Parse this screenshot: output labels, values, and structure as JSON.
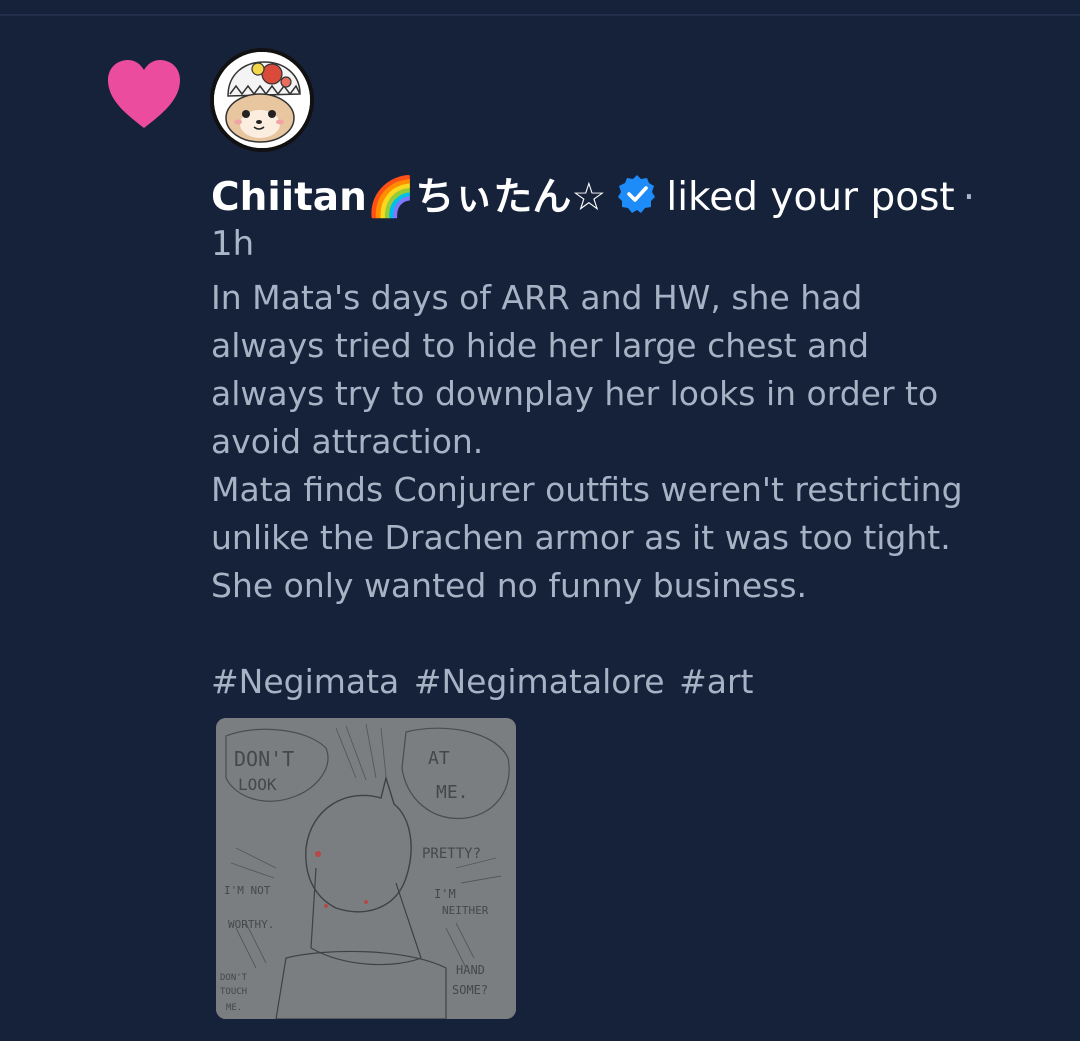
{
  "notification": {
    "type_icon": "heart-icon",
    "user": {
      "name": "Chiitan🌈ちぃたん☆",
      "verified": true,
      "avatar_icon": "avatar-image"
    },
    "action": "liked your post",
    "separator": "·",
    "time": "1h",
    "post": {
      "lines": [
        "In Mata's days of ARR and HW, she had",
        "always tried to hide her large chest and",
        "always try to downplay her looks in order to",
        "avoid attraction.",
        "Mata finds Conjurer outfits weren't restricting",
        "unlike the Drachen armor as it was too tight.",
        "She only wanted no funny business."
      ],
      "hashtags": [
        "#Negimata",
        "#Negimatalore",
        "#art"
      ],
      "image": {
        "texts": [
          "DON'T",
          "LOOK",
          "AT",
          "ME.",
          "PRETTY?",
          "I'M NOT",
          "WORTHY.",
          "I'M",
          "NEITHER",
          "DON'T",
          "TOUCH",
          "ME.",
          "HAND",
          "SOME?"
        ]
      }
    }
  },
  "colors": {
    "background": "#16213a",
    "heart": "#ec4c9d",
    "verified": "#1d8cf8",
    "text_primary": "#ffffff",
    "text_secondary": "#a7b2c5"
  }
}
